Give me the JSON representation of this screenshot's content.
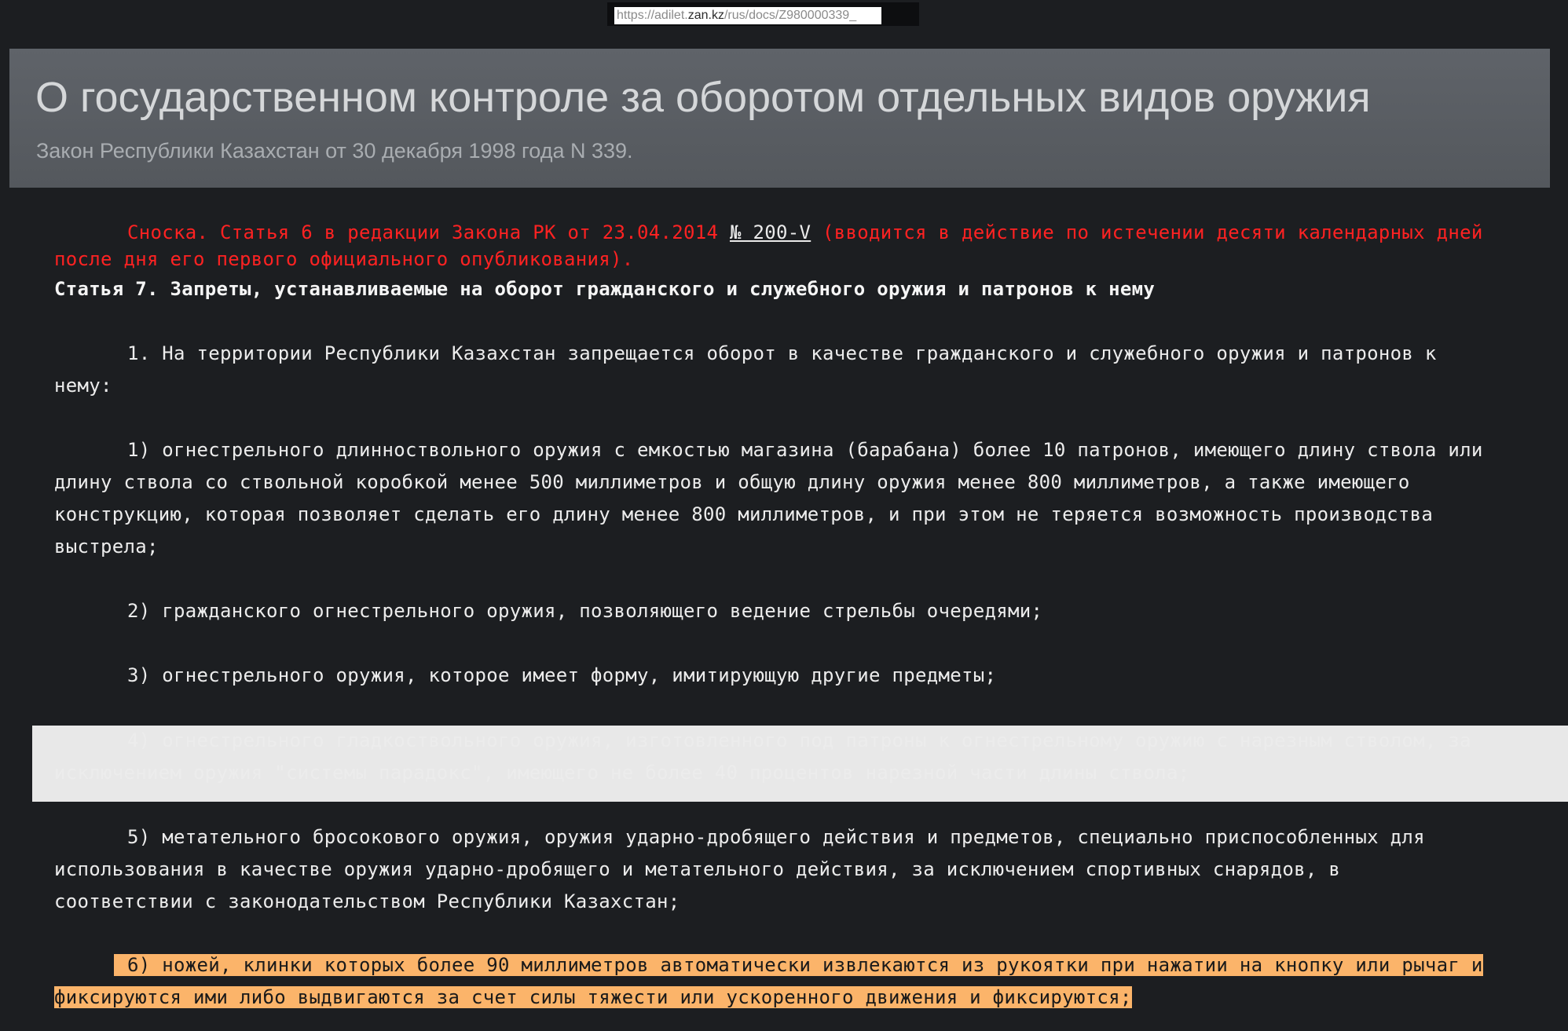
{
  "browser": {
    "url_prefix": "https://adilet.",
    "url_host": "zan.kz",
    "url_path": "/rus/docs/Z980000339_"
  },
  "header": {
    "title": "О государственном контроле за оборотом отдельных видов оружия",
    "subtitle": "Закон Республики Казахстан от 30 декабря 1998 года N 339."
  },
  "footnote": {
    "line1_pre": "Сноска. Статья 6 в редакции Закона РК от 23.04.2014 ",
    "link": "№ 200-V",
    "line1_post": " (вводится в действие по истечении десяти календарных дней",
    "line2": "после дня его первого официального опубликования)."
  },
  "article": {
    "heading": "Статья 7. Запреты, устанавливаемые на оборот гражданского и служебного оружия и патронов к нему",
    "p1": [
      "1. На территории Республики Казахстан запрещается оборот в качестве гражданского и служебного оружия и патронов к",
      "нему:"
    ],
    "item1": [
      "1) огнестрельного длинноствольного оружия с емкостью магазина (барабана) более 10 патронов, имеющего длину ствола или",
      "длину ствола со ствольной коробкой менее 500 миллиметров и общую длину оружия менее 800 миллиметров, а также имеющего",
      "конструкцию, которая позволяет сделать его длину менее 800 миллиметров, и при этом не теряется возможность производства",
      "выстрела;"
    ],
    "item2": [
      "2) гражданского огнестрельного оружия, позволяющего ведение стрельбы очередями;"
    ],
    "item3": [
      "3) огнестрельного оружия, которое имеет форму, имитирующую другие предметы;"
    ],
    "item4": [
      "4) огнестрельного гладкоствольного оружия, изготовленного под патроны к огнестрельному оружию с нарезным стволом, за",
      "исключением оружия \"системы парадокс\", имеющего не более 40 процентов нарезной части длины ствола;"
    ],
    "item5": [
      "5) метательного бросокового оружия, оружия ударно-дробящего действия и предметов, специально приспособленных для",
      "использования в качестве оружия ударно-дробящего и метательного действия, за исключением спортивных снарядов, в",
      "соответствии с законодательством Республики Казахстан;"
    ],
    "item6": [
      "6) ножей, клинки которых более 90 миллиметров автоматически извлекаются из рукоятки при нажатии на кнопку или рычаг и",
      "фиксируются ими либо выдвигаются за счет силы тяжести или ускоренного движения и фиксируются;"
    ]
  },
  "colors": {
    "background": "#1c1e21",
    "header_bg": "#5a5e63",
    "footnote_red": "#ff2222",
    "highlight": "#fbb46a"
  }
}
